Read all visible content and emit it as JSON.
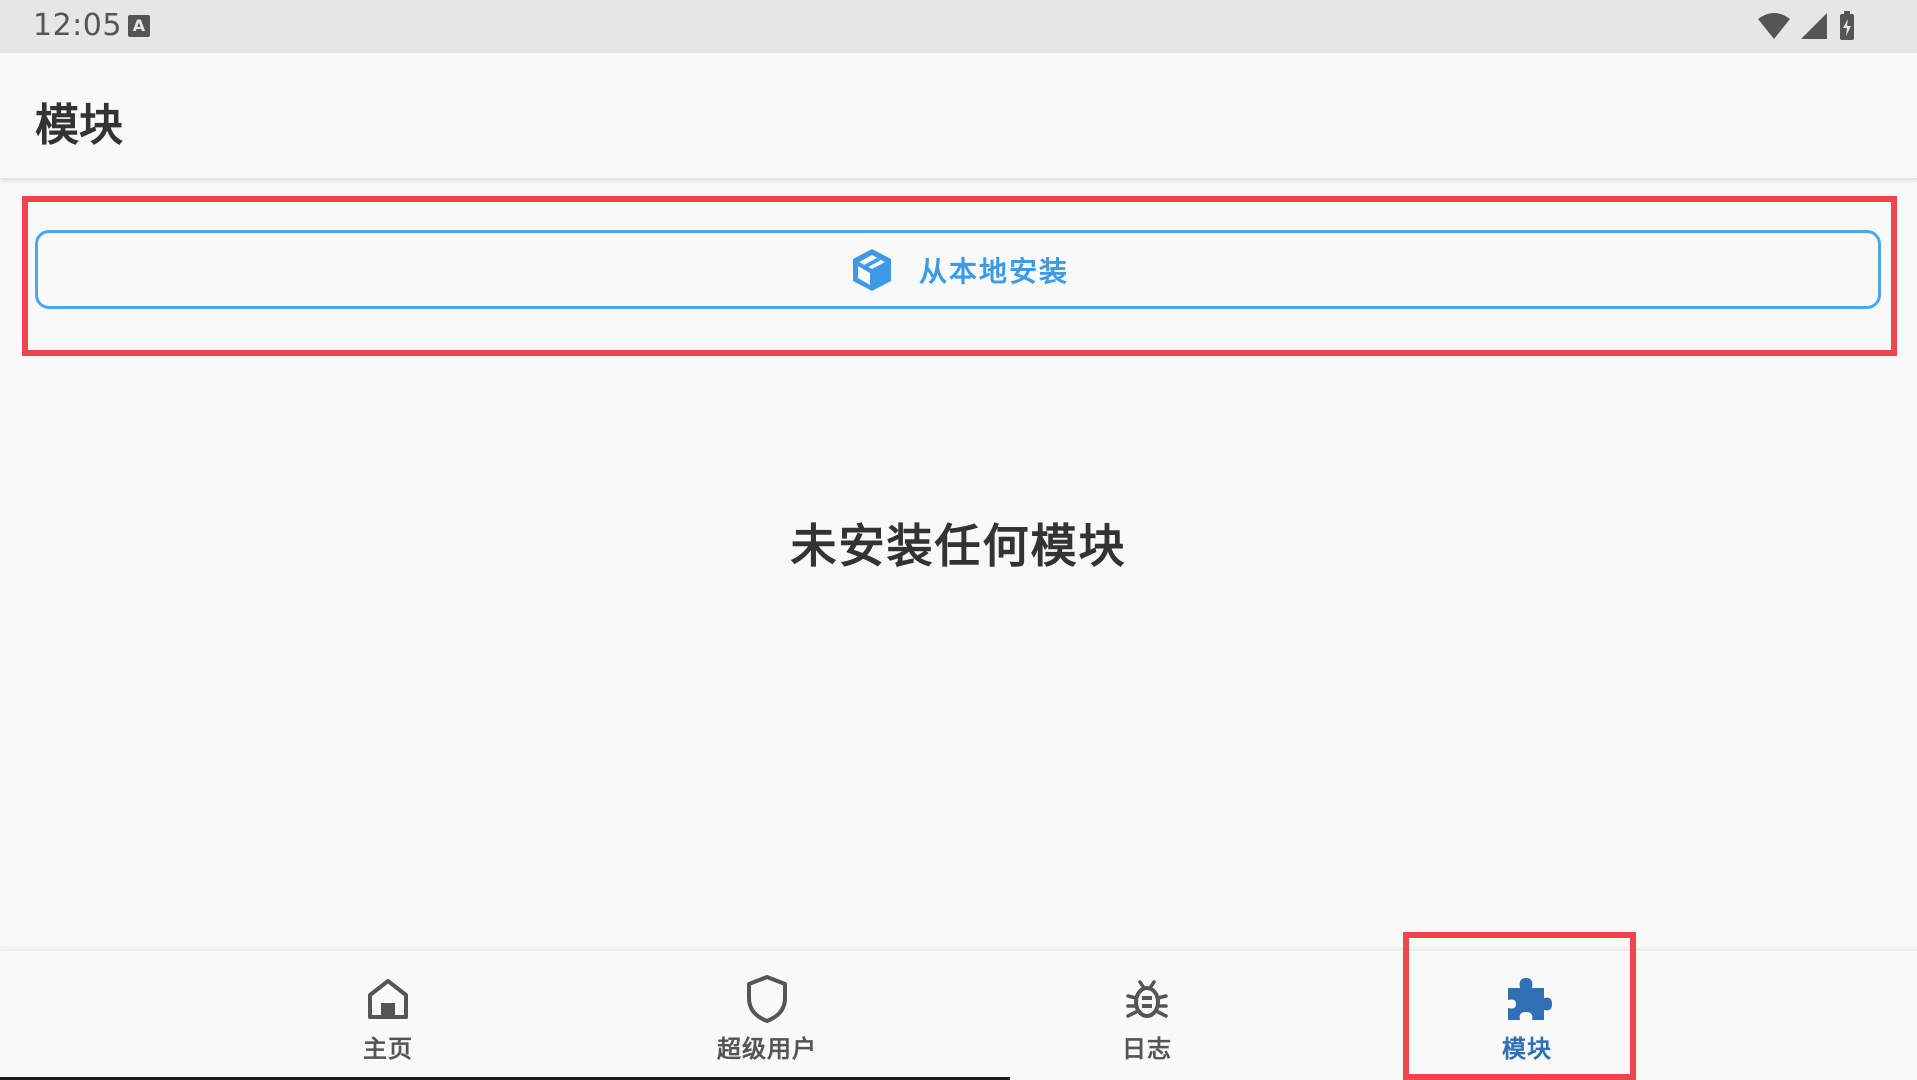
{
  "status_bar": {
    "time": "12:05",
    "notification_badge": "A"
  },
  "app_bar": {
    "title": "模块"
  },
  "install_button": {
    "label": "从本地安装",
    "icon": "package-box-icon",
    "color": "#3d9ae6"
  },
  "empty_state": {
    "message": "未安装任何模块"
  },
  "bottom_nav": {
    "items": [
      {
        "label": "主页",
        "icon": "home-icon",
        "active": false
      },
      {
        "label": "超级用户",
        "icon": "shield-icon",
        "active": false
      },
      {
        "label": "日志",
        "icon": "bug-icon",
        "active": false
      },
      {
        "label": "模块",
        "icon": "puzzle-icon",
        "active": true
      }
    ],
    "active_color": "#2f6fb3",
    "inactive_color": "#555555"
  },
  "highlight_color": "#f0454e"
}
